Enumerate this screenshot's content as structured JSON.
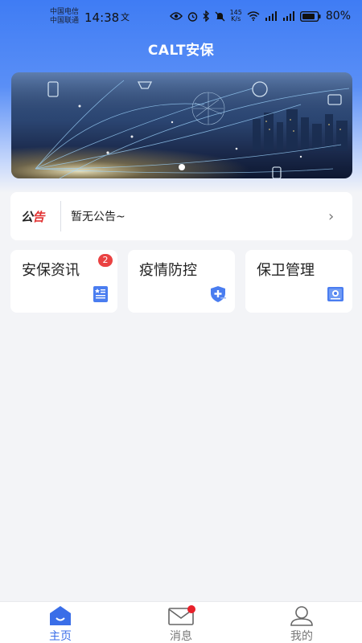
{
  "status_bar": {
    "carrier_1": "中国电信",
    "carrier_2": "中国联通",
    "time": "14:38",
    "time_extra": "文",
    "network_speed_value": "145",
    "network_speed_unit": "K/s",
    "battery": "80%"
  },
  "header": {
    "title": "CALT安保"
  },
  "banner": {
    "slide_count": 1,
    "active_index": 0
  },
  "notice": {
    "label_a": "公",
    "label_b": "告",
    "text": "暂无公告~",
    "arrow": "›"
  },
  "tiles": [
    {
      "label": "安保资讯",
      "badge": "2",
      "icon": "news-icon",
      "accent": "#4a7df0"
    },
    {
      "label": "疫情防控",
      "icon": "shield-plus-icon",
      "accent": "#4a7df0"
    },
    {
      "label": "保卫管理",
      "icon": "security-manage-icon",
      "accent": "#4a7df0"
    }
  ],
  "tabbar": {
    "items": [
      {
        "label": "主页",
        "icon": "home-icon",
        "active": true
      },
      {
        "label": "消息",
        "icon": "mail-icon",
        "active": false,
        "has_dot": true
      },
      {
        "label": "我的",
        "icon": "user-icon",
        "active": false
      }
    ]
  },
  "colors": {
    "primary": "#3a6ee8",
    "badge": "#ea4242",
    "background": "#f3f4f7"
  }
}
